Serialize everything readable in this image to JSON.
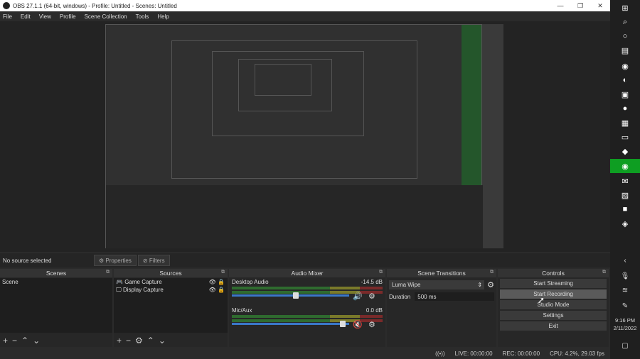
{
  "window": {
    "title": "OBS 27.1.1 (64-bit, windows) - Profile: Untitled - Scenes: Untitled"
  },
  "menu": [
    "File",
    "Edit",
    "View",
    "Profile",
    "Scene Collection",
    "Tools",
    "Help"
  ],
  "source_toolbar": {
    "selected": "No source selected",
    "properties": "Properties",
    "filters": "Filters"
  },
  "docks": {
    "scenes": {
      "title": "Scenes",
      "items": [
        "Scene"
      ]
    },
    "sources": {
      "title": "Sources",
      "items": [
        "Game Capture",
        "Display Capture"
      ]
    },
    "mixer": {
      "title": "Audio Mixer",
      "channels": [
        {
          "name": "Desktop Audio",
          "db": "-14.5 dB",
          "volume": 0.55,
          "muted": false
        },
        {
          "name": "Mic/Aux",
          "db": "0.0 dB",
          "volume": 0.97,
          "muted": true
        }
      ]
    },
    "transitions": {
      "title": "Scene Transitions",
      "selected": "Luma Wipe",
      "duration_label": "Duration",
      "duration": "500 ms"
    },
    "controls": {
      "title": "Controls",
      "buttons": [
        "Start Streaming",
        "Start Recording",
        "Studio Mode",
        "Settings",
        "Exit"
      ]
    }
  },
  "status": {
    "live": "LIVE: 00:00:00",
    "rec": "REC: 00:00:00",
    "cpu": "CPU: 4.2%, 29.03 fps"
  },
  "clock": {
    "time": "9:16 PM",
    "date": "2/11/2022"
  },
  "colors": {
    "accent": "#3a78c8",
    "taskbar_highlight": "#0e9e22"
  }
}
